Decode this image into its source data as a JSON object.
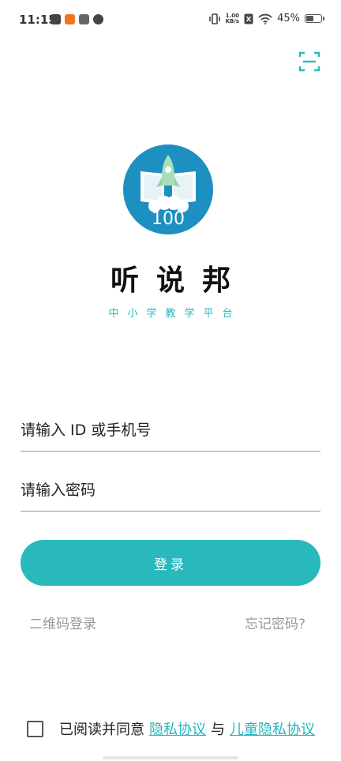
{
  "status_bar": {
    "time": "11:15",
    "net_speed_value": "1.00",
    "net_speed_unit": "KB/s",
    "battery_percent": "45%",
    "battery_level": 0.45
  },
  "logo": {
    "badge": "100"
  },
  "app": {
    "name": "听说邦",
    "slogan": "中小学教学平台"
  },
  "form": {
    "account_placeholder": "请输入 ID 或手机号",
    "password_placeholder": "请输入密码",
    "login_label": "登录"
  },
  "links": {
    "qr_login": "二维码登录",
    "forgot_password": "忘记密码?"
  },
  "agreement": {
    "prefix": "已阅读并同意",
    "privacy": "隐私协议",
    "joiner": "与",
    "child_privacy": "儿童隐私协议"
  },
  "colors": {
    "accent": "#29b9bd",
    "logo_bg": "#1d8fc0",
    "rocket": "#a8dfb9"
  }
}
